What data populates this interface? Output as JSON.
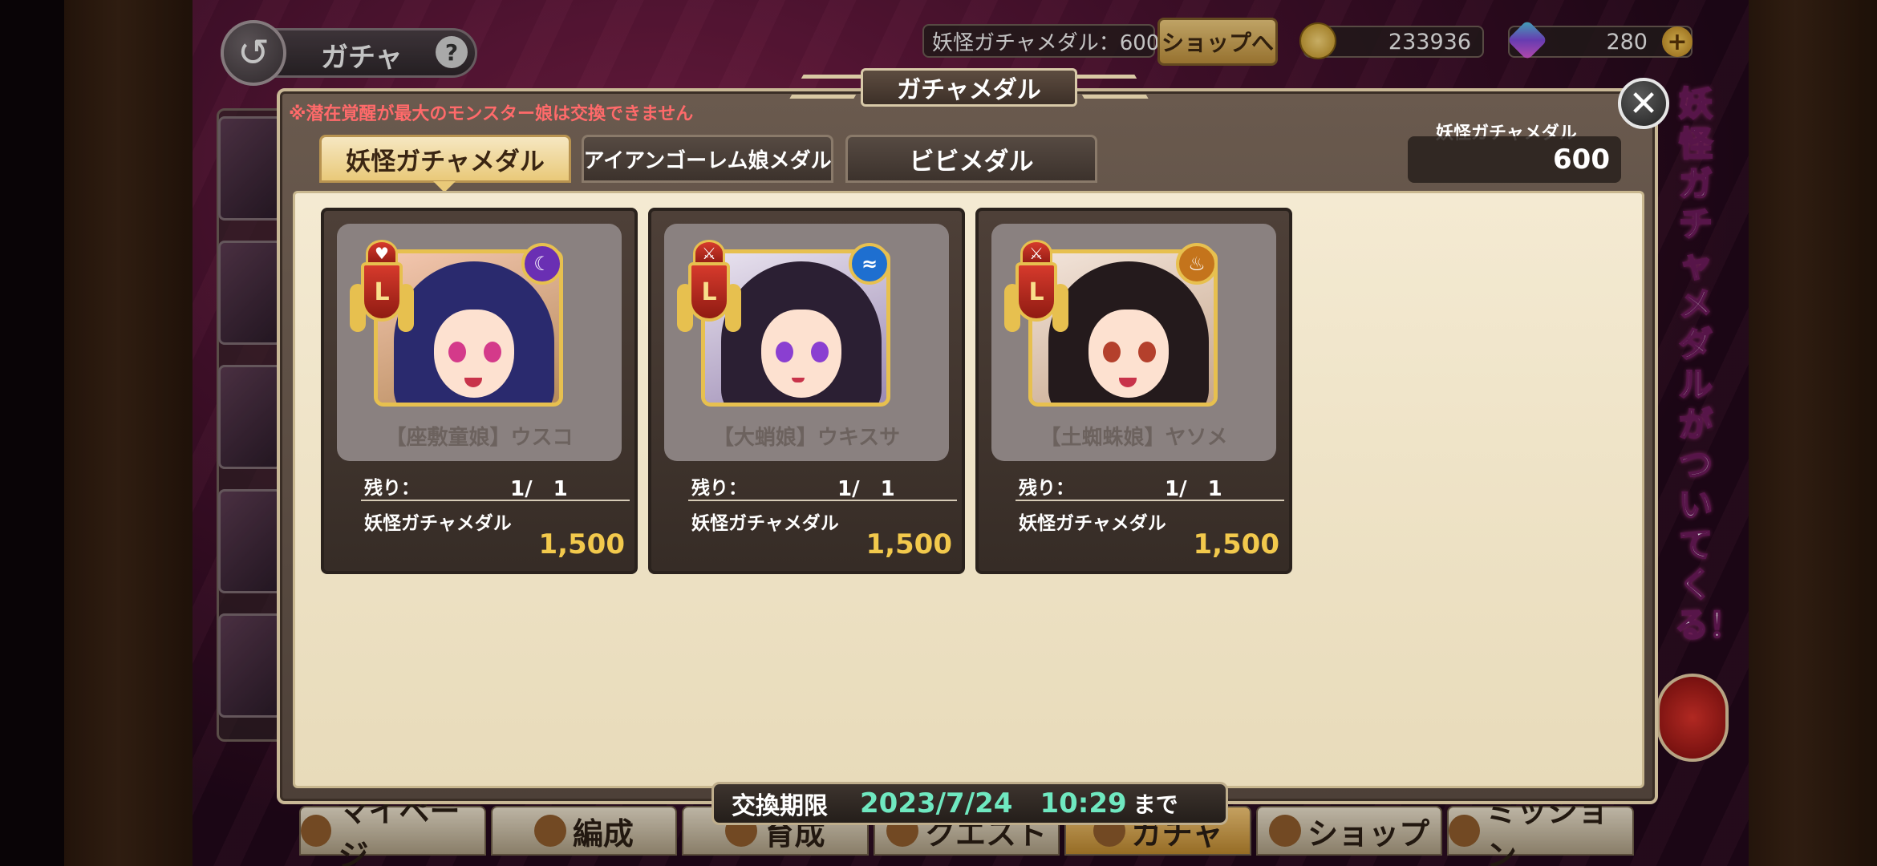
{
  "header": {
    "back_icon": "back-arrow-icon",
    "title": "ガチャ",
    "help": "?",
    "medal_count": "妖怪ガチャメダル：600",
    "shop_button": "ショップへ",
    "coins": "233936",
    "gems": "280",
    "plus": "+"
  },
  "side_banner": {
    "text": "妖怪ガチャメダルがついてくる！"
  },
  "bottom_nav": {
    "items": [
      {
        "label": "マイページ"
      },
      {
        "label": "編成"
      },
      {
        "label": "育成"
      },
      {
        "label": "クエスト"
      },
      {
        "label": "ガチャ"
      },
      {
        "label": "ショップ"
      },
      {
        "label": "ミッション"
      }
    ]
  },
  "modal": {
    "title": "ガチャメダル",
    "close": "✕",
    "notice": "※潜在覚醒が最大のモンスター娘は交換できません",
    "tabs": [
      {
        "label": "妖怪ガチャメダル",
        "active": true
      },
      {
        "label": "アイアンゴーレム娘メダル",
        "active": false
      },
      {
        "label": "ビビメダル",
        "active": false
      }
    ],
    "balance_label": "妖怪ガチャメダル",
    "balance_value": "600",
    "items": [
      {
        "name": "【座敷童娘】ウスコ",
        "rank": "L",
        "rank_icon": "heart-icon",
        "element_icon": "dark-element-icon",
        "element_color": "#6a2fb3",
        "hair_color": "#2a2a6e",
        "eye_color": "#d43a8a",
        "remain_label": "残り：",
        "remain_value": "1/　1",
        "cost_label": "妖怪ガチャメダル",
        "cost_value": "1,500"
      },
      {
        "name": "【大蛸娘】ウキスサ",
        "rank": "L",
        "rank_icon": "crossed-swords-icon",
        "element_icon": "water-element-icon",
        "element_color": "#1e6fd0",
        "hair_color": "#2b1f33",
        "eye_color": "#8a3fd1",
        "remain_label": "残り：",
        "remain_value": "1/　1",
        "cost_label": "妖怪ガチャメダル",
        "cost_value": "1,500"
      },
      {
        "name": "【土蜘蛛娘】ヤソメ",
        "rank": "L",
        "rank_icon": "crossed-swords-icon",
        "element_icon": "fire-element-icon",
        "element_color": "#c4741c",
        "hair_color": "#241a1c",
        "eye_color": "#b4402c",
        "remain_label": "残り：",
        "remain_value": "1/　1",
        "cost_label": "妖怪ガチャメダル",
        "cost_value": "1,500"
      }
    ],
    "expiry": {
      "label": "交換期限",
      "date": "2023/7/24",
      "time": "10:29",
      "suffix": "まで"
    }
  }
}
